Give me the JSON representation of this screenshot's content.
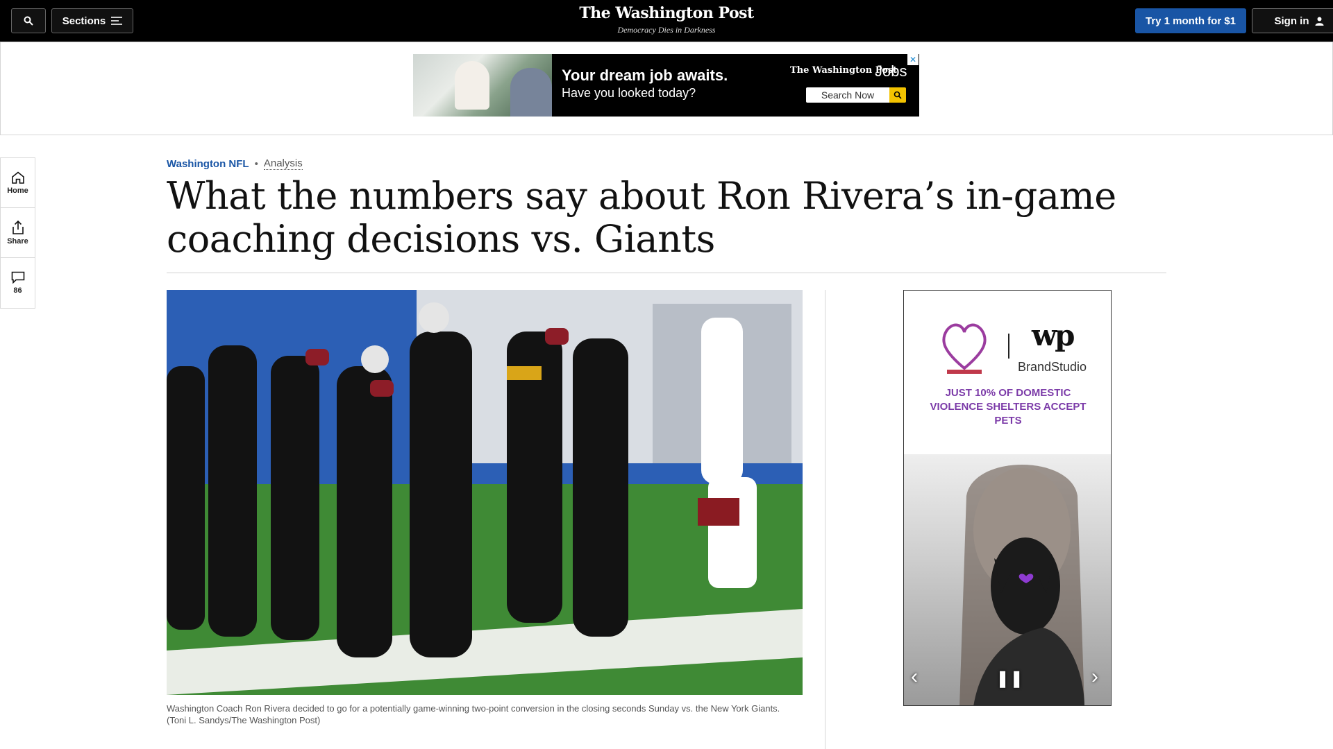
{
  "topbar": {
    "sections_label": "Sections",
    "logo_name": "The Washington Post",
    "tagline": "Democracy Dies in Darkness",
    "subscribe_label": "Try 1 month for $1",
    "signin_label": "Sign in"
  },
  "top_ad": {
    "headline": "Your dream job awaits.",
    "subline": "Have you looked today?",
    "brand": "The Washington Post",
    "jobs": "Jobs",
    "search_label": "Search Now"
  },
  "rail": {
    "home_label": "Home",
    "share_label": "Share",
    "comments_count": "86"
  },
  "article": {
    "section": "Washington NFL",
    "label": "Analysis",
    "headline": "What the numbers say about Ron Rivera’s in-game coaching decisions vs. Giants",
    "caption": "Washington Coach Ron Rivera decided to go for a potentially game-winning two-point conversion in the closing seconds Sunday vs. the New York Giants. (Toni L. Sandys/The Washington Post)"
  },
  "side_ad": {
    "wp_mark": "wp",
    "brandstudio": "BrandStudio",
    "message": "JUST 10% OF DOMESTIC VIOLENCE SHELTERS ACCEPT PETS"
  },
  "colors": {
    "accent_blue": "#1955a5",
    "topbar_bg": "#000000",
    "ad_purple": "#7b3aa8"
  }
}
